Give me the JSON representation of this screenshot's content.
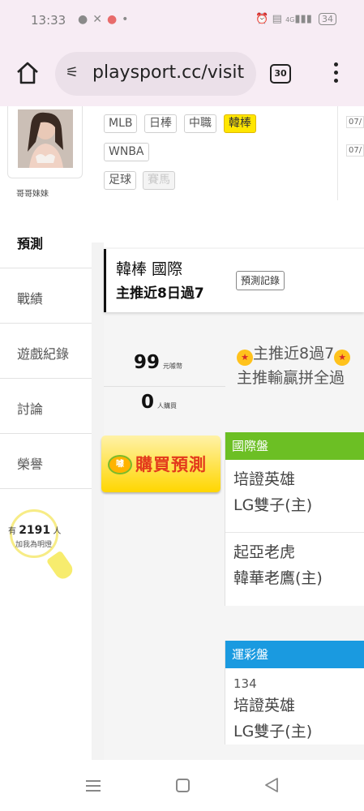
{
  "status_bar": {
    "time": "13:33",
    "notification_icons": [
      "chat-icon",
      "fan-icon",
      "app-icon",
      "dot-icon"
    ],
    "right_icons": [
      "alarm-icon",
      "volte-icon",
      "signal-icon"
    ],
    "network_label": "4G",
    "battery": "34"
  },
  "browser": {
    "url": "playsport.cc/visit",
    "tab_count": "30"
  },
  "profile": {
    "name": "哥哥妹妹"
  },
  "leagues": {
    "row1": [
      "MLB",
      "日棒",
      "中職",
      "韓棒"
    ],
    "row2": [
      "WNBA"
    ],
    "row3": [
      "足球",
      "賽馬"
    ],
    "active": "韓棒",
    "disabled": "賽馬",
    "accent_color": "#ffe600"
  },
  "side_dates": [
    "07/",
    "07/"
  ],
  "menu": [
    {
      "label": "預測",
      "current": true
    },
    {
      "label": "戰績"
    },
    {
      "label": "遊戲紀錄"
    },
    {
      "label": "討論"
    },
    {
      "label": "榮譽"
    }
  ],
  "fans": {
    "prefix": "有",
    "count": "2191",
    "unit": "人",
    "caption": "加我為明燈"
  },
  "prediction": {
    "league": "韓棒 國際",
    "record_label": "預測記錄",
    "subtitle": "主推近8日過7",
    "price": "99",
    "price_unit": "元噱幣",
    "buyers": "0",
    "buyers_unit": "人購買",
    "buy_label": "購買預測",
    "buy_badge": "噱",
    "headline1": "主推近8過7",
    "headline2": "主推輸贏拼全過"
  },
  "cards": [
    {
      "title": "國際盤",
      "color": "#6cbf24",
      "games": [
        {
          "away": "培證英雄",
          "home": "LG雙子(主)"
        },
        {
          "away": "起亞老虎",
          "home": "韓華老鷹(主)"
        }
      ]
    },
    {
      "title": "運彩盤",
      "color": "#1a9ae0",
      "number": "134",
      "games": [
        {
          "away": "培證英雄",
          "home": "LG雙子(主)"
        }
      ]
    }
  ]
}
